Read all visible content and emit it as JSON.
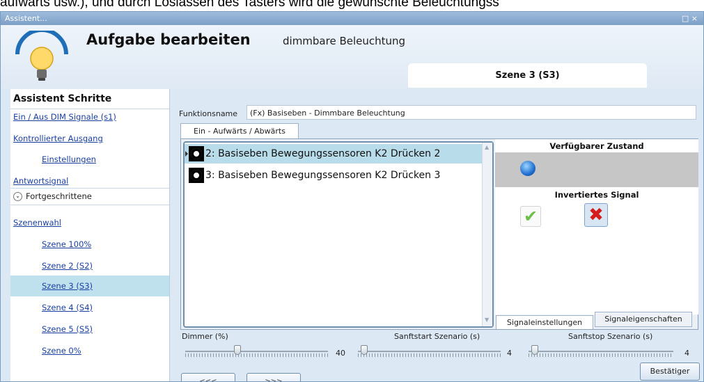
{
  "document_text": "aufwärts usw.), und durch Loslassen des Tasters wird die gewünschte Beleuchtungss",
  "window": {
    "title": "Assistent...",
    "controls": "□ ×"
  },
  "header": {
    "title": "Aufgabe bearbeiten",
    "subtitle": "dimmbare Beleuchtung",
    "scene_tab": "Szene 3 (S3)",
    "icon": "lightbulb-icon"
  },
  "sidebar": {
    "title": "Assistent Schritte",
    "items": [
      {
        "label": "Ein / Aus DIM Signale (s1)"
      },
      {
        "label": "Kontrollierter Ausgang"
      },
      {
        "label": "Einstellungen"
      },
      {
        "label": "Antwortsignal"
      }
    ],
    "advanced_label": "Fortgeschrittene",
    "scene_items": [
      {
        "label": "Szenenwahl"
      },
      {
        "label": "Szene 100%"
      },
      {
        "label": "Szene 2 (S2)"
      },
      {
        "label": "Szene 3 (S3)"
      },
      {
        "label": "Szene 4 (S4)"
      },
      {
        "label": "Szene 5 (S5)"
      },
      {
        "label": "Szene 0%"
      }
    ]
  },
  "main": {
    "function_name_label": "Funktionsname",
    "function_name_value": "(Fx) Basiseben - Dimmbare Beleuchtung",
    "tab": "Ein - Aufwärts / Abwärts",
    "list": [
      {
        "text": "2: Basiseben Bewegungssensoren K2 Drücken 2",
        "selected": true
      },
      {
        "text": "3: Basiseben Bewegungssensoren K2 Drücken 3",
        "selected": false
      }
    ],
    "panel": {
      "available_state": "Verfügbarer Zustand",
      "inverted_signal": "Invertiertes Signal",
      "check_icon": "✔",
      "x_icon": "✖"
    },
    "right_tabs": {
      "signal_settings": "Signaleinstellungen",
      "signal_properties": "Signaleigenschaften"
    },
    "sliders": [
      {
        "label": "Dimmer (%)",
        "value": "40",
        "fraction": 0.36
      },
      {
        "label": "Sanftstart Szenario (s)",
        "value": "4",
        "fraction": 0.02
      },
      {
        "label": "Sanftstop Szenario (s)",
        "value": "4",
        "fraction": 0.02
      }
    ],
    "buttons": {
      "prev": "<<<",
      "next": ">>>",
      "confirm": "Bestätiger"
    }
  },
  "colors": {
    "accent": "#bfe1ee",
    "window_bg": "#dce8f3",
    "link": "#1a3fa0"
  }
}
